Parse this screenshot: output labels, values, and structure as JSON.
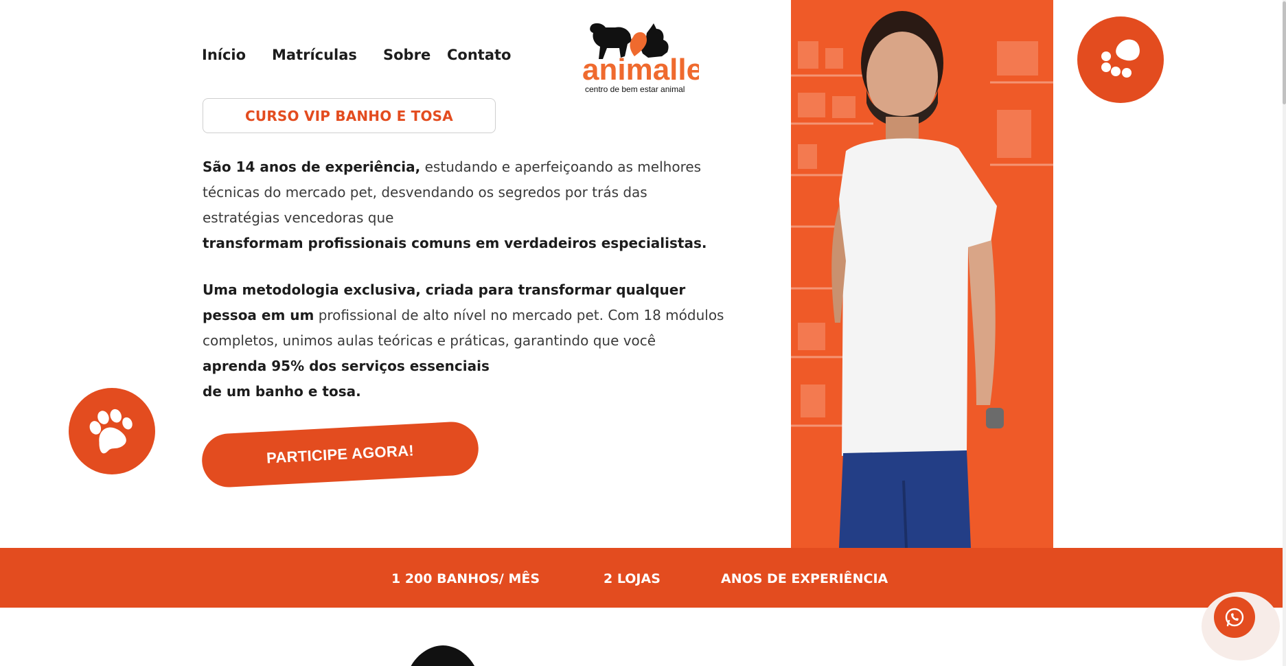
{
  "nav": {
    "items": [
      "Início",
      "Matrículas",
      "Sobre",
      "Contato"
    ]
  },
  "logo": {
    "name": "animalle",
    "tagline": "centro de bem estar animal"
  },
  "course_badge": "CURSO VIP BANHO E TOSA",
  "intro": {
    "p1_bold_a": "São 14 anos de experiência,",
    "p1_text_a": " estudando e aperfeiçoando as melhores técnicas do mercado pet, desvendando os segredos por trás das estratégias vencedoras que ",
    "p1_bold_b": "transformam profissionais comuns em verdadeiros especialistas.",
    "p2_bold_a": "Uma metodologia exclusiva, criada para transformar qualquer pessoa em um",
    "p2_text_a": " profissional de alto nível no mercado pet. Com 18 módulos completos, unimos aulas teóricas e práticas, garantindo que você ",
    "p2_bold_b": "aprenda 95% dos serviços essenciais",
    "p2_bold_c": "de um banho e tosa."
  },
  "cta": "PARTICIPE AGORA!",
  "stats": [
    "1 200 BANHOS/ MÊS",
    "2 LOJAS",
    "ANOS DE EXPERIÊNCIA"
  ],
  "icons": {
    "paw_left": "paw-icon",
    "paw_right": "paw-icon",
    "whatsapp": "whatsapp-icon"
  },
  "colors": {
    "accent": "#e34c1f",
    "photo_overlay": "#ef5a28"
  }
}
